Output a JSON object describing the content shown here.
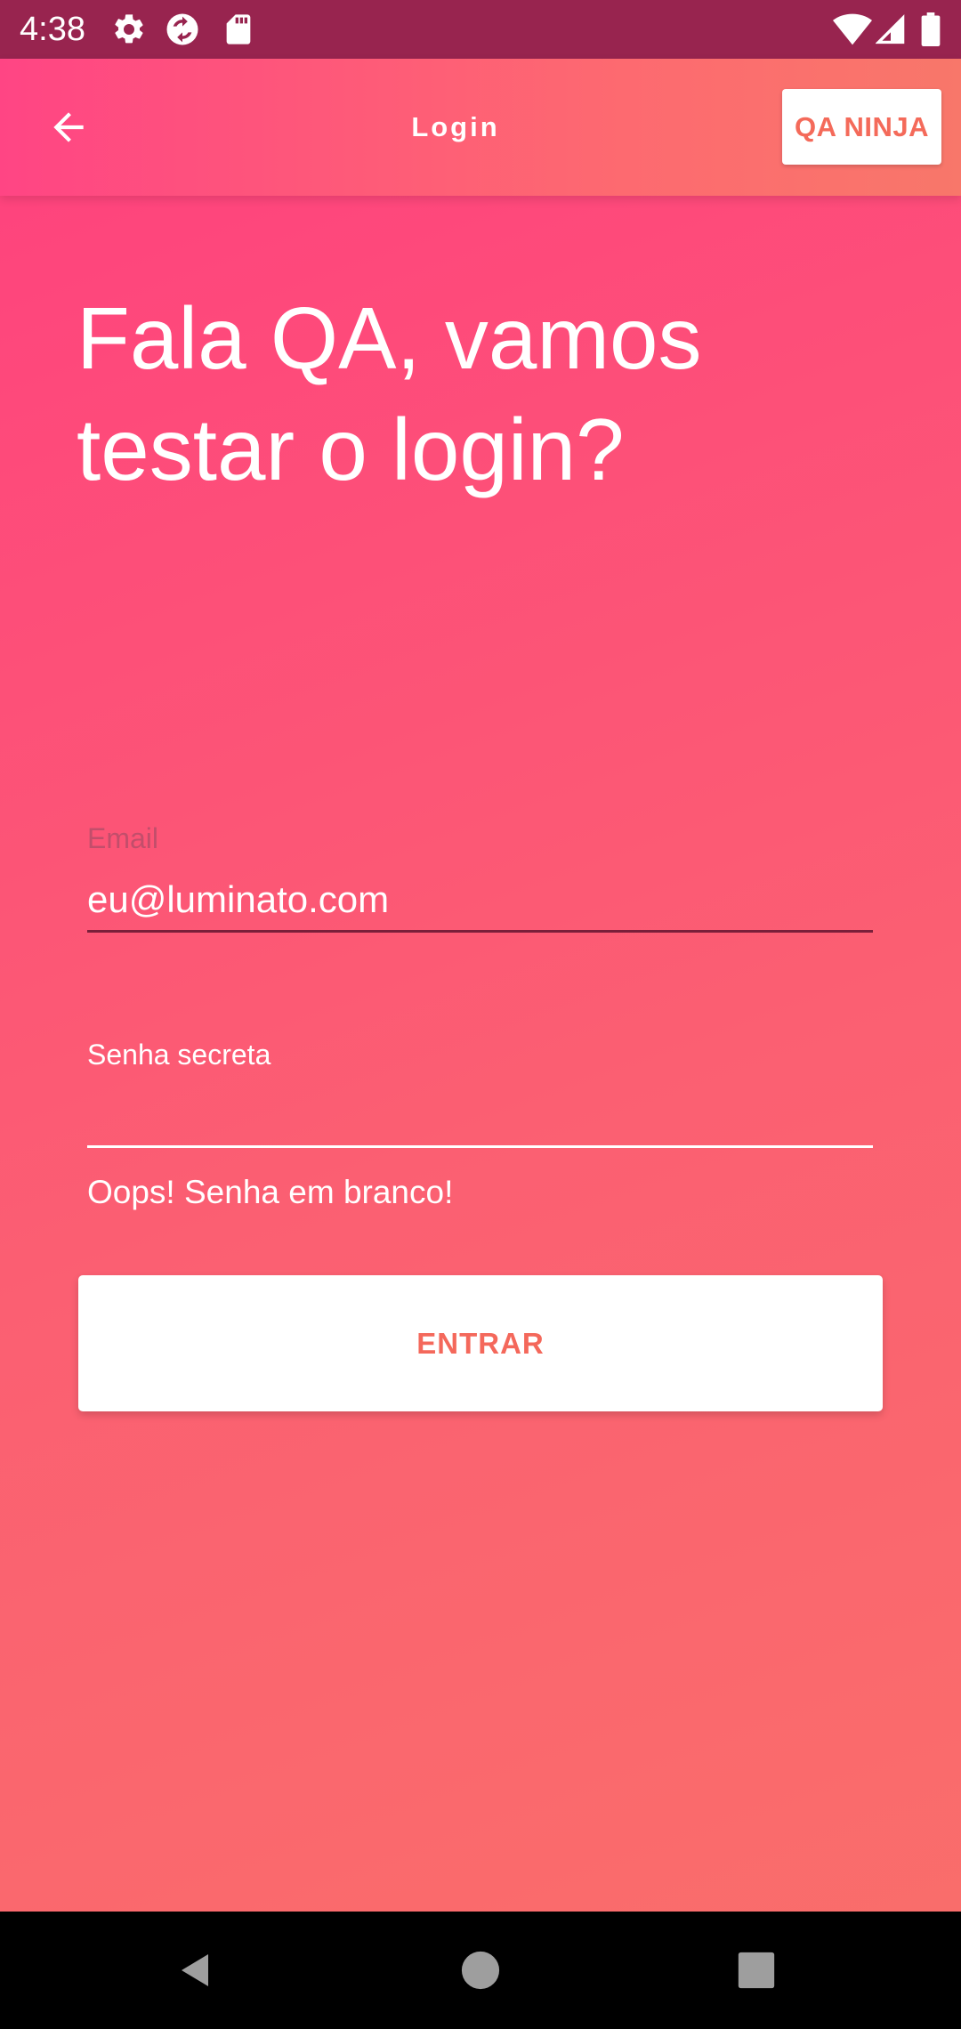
{
  "status_bar": {
    "time": "4:38",
    "left_icons": [
      "settings-icon",
      "sync-icon",
      "sd-card-icon"
    ],
    "right_icons": [
      "wifi-icon",
      "cell-signal-icon",
      "battery-icon"
    ]
  },
  "app_bar": {
    "title": "Login",
    "action_label": "QA NINJA",
    "back_icon": "arrow-back-icon"
  },
  "headline": {
    "line1": "Fala QA, vamos",
    "line2": "testar o login?"
  },
  "form": {
    "email": {
      "label": "Email",
      "value": "eu@luminato.com"
    },
    "password": {
      "label": "Senha secreta",
      "value": "",
      "error": "Oops! Senha em branco!"
    },
    "submit_label": "ENTRAR"
  },
  "nav_bar": {
    "buttons": [
      "back-triangle-icon",
      "home-circle-icon",
      "recents-square-icon"
    ]
  },
  "colors": {
    "status_bar": "#98244f",
    "gradient_top": "#ff3f7f",
    "gradient_bottom": "#f96f6a",
    "accent_text": "#f46a5a"
  }
}
